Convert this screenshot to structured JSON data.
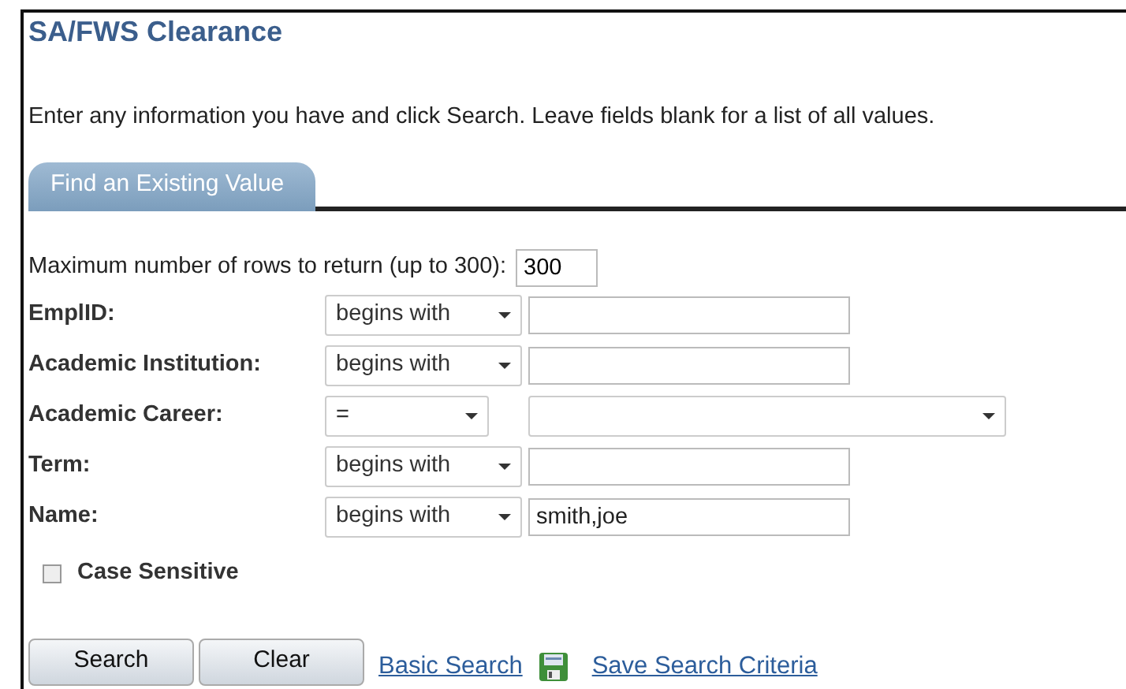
{
  "title": "SA/FWS Clearance",
  "instructions": "Enter any information you have and click Search. Leave fields blank for a list of all values.",
  "tabs": [
    {
      "label": "Find an Existing Value",
      "selected": true
    }
  ],
  "max_rows": {
    "label": "Maximum number of rows to return (up to 300):",
    "value": "300"
  },
  "fields": [
    {
      "label": "EmplID:",
      "kind": "text",
      "operator": "begins with"
    },
    {
      "label": "Academic Institution:",
      "kind": "text",
      "operator": "begins with"
    },
    {
      "label": "Academic Career:",
      "kind": "dropdown",
      "operator": "="
    },
    {
      "label": "Term:",
      "kind": "text",
      "operator": "begins with"
    },
    {
      "label": "Name:",
      "kind": "text",
      "operator": "begins with",
      "value": "smith,joe"
    }
  ],
  "case_sensitive": {
    "label": "Case Sensitive",
    "checked": false
  },
  "buttons": [
    "Search",
    "Clear"
  ],
  "links": [
    {
      "label": "Basic Search",
      "kind": "plain"
    },
    {
      "label": "Save Search Criteria",
      "kind": "save"
    }
  ]
}
